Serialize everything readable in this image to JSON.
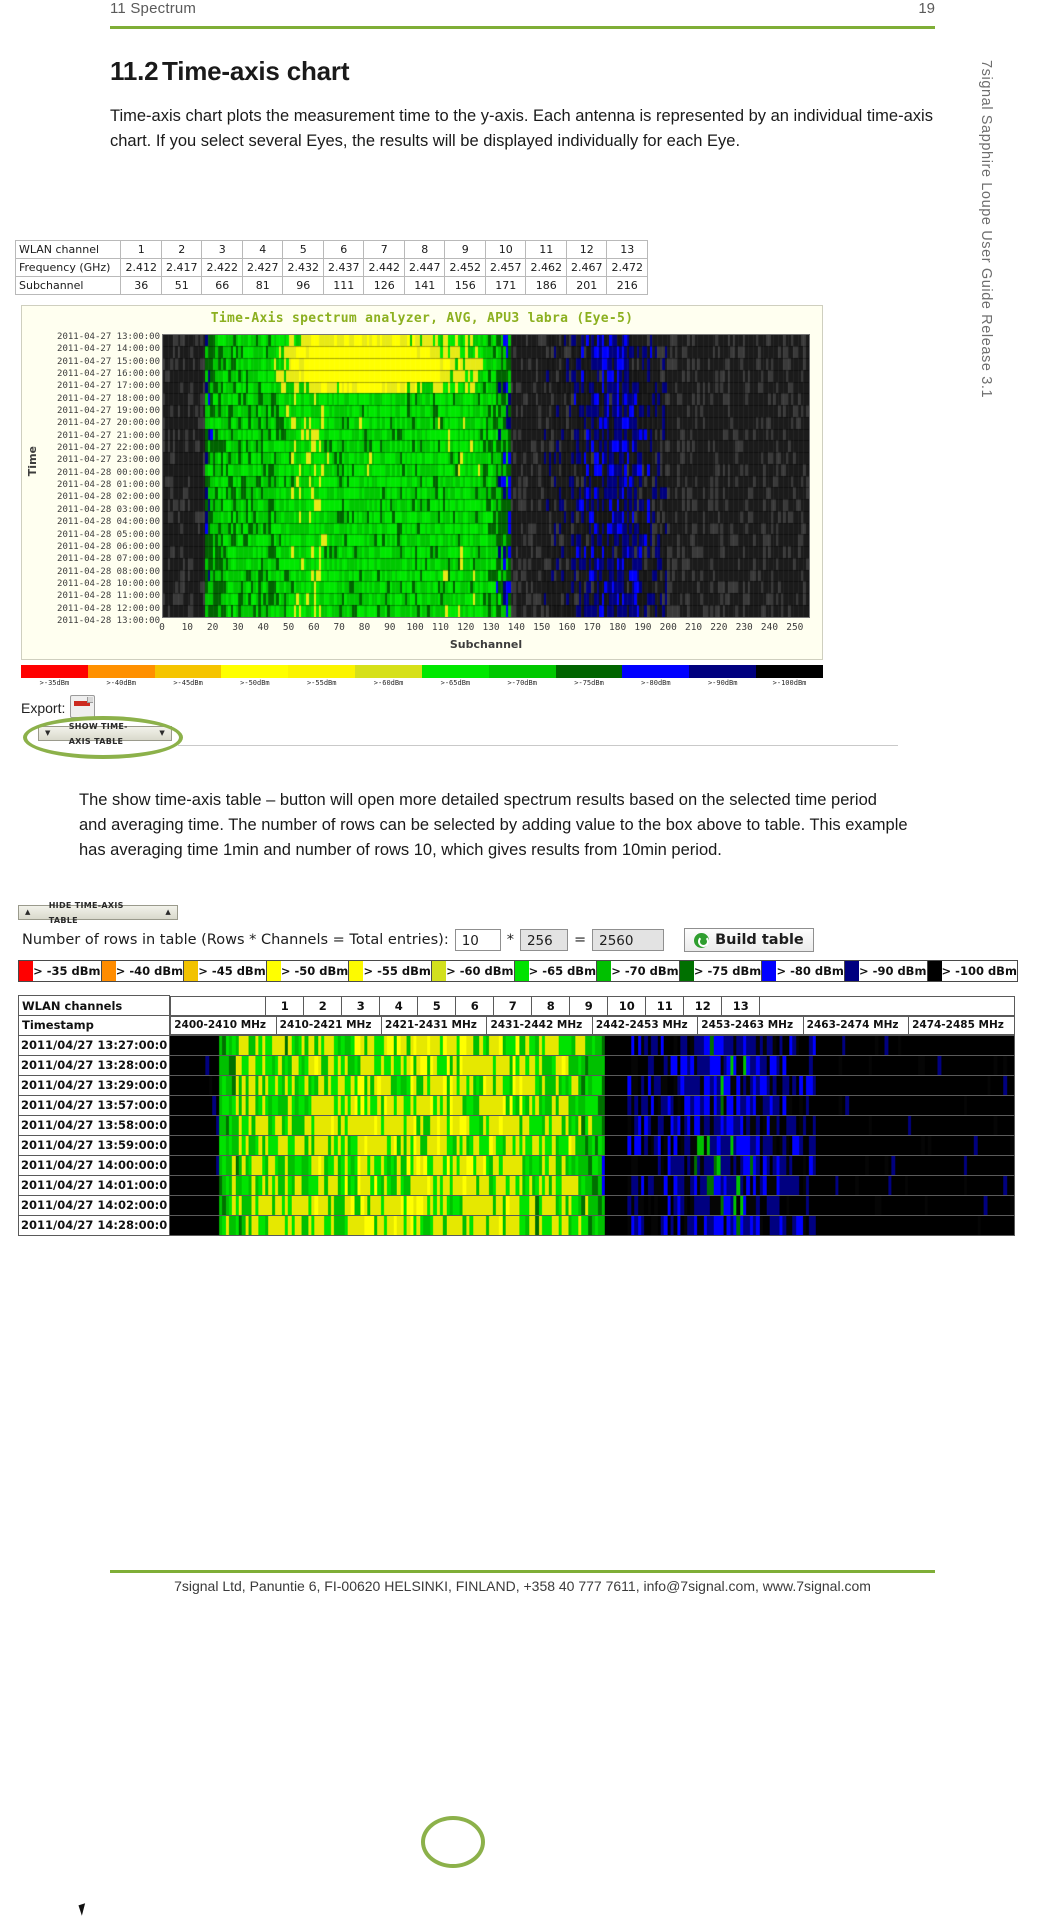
{
  "header": {
    "left": "11 Spectrum",
    "page_number": "19"
  },
  "side_text": "7signal Sapphire Loupe User Guide Release 3.1",
  "footer": "7signal Ltd, Panuntie 6, FI-00620 HELSINKI, FINLAND, +358 40 777 7611, info@7signal.com, www.7signal.com",
  "section": {
    "number": "11.2",
    "title": "Time-axis chart",
    "paragraph1": "Time-axis chart plots the measurement time to the y-axis. Each antenna is represented by an individual time-axis chart. If you select several Eyes, the results will be displayed individually for each Eye.",
    "paragraph2": "The show time-axis table – button will open more detailed spectrum results based on the selected time period and averaging time. The number of rows can be selected by adding value to the box above to table. This example has averaging time 1min and number of rows 10, which gives results from 10min period."
  },
  "wlan_table": {
    "row_labels": [
      "WLAN channel",
      "Frequency (GHz)",
      "Subchannel"
    ],
    "channels": [
      "1",
      "2",
      "3",
      "4",
      "5",
      "6",
      "7",
      "8",
      "9",
      "10",
      "11",
      "12",
      "13"
    ],
    "frequencies": [
      "2.412",
      "2.417",
      "2.422",
      "2.427",
      "2.432",
      "2.437",
      "2.442",
      "2.447",
      "2.452",
      "2.457",
      "2.462",
      "2.467",
      "2.472"
    ],
    "subchannels": [
      "36",
      "51",
      "66",
      "81",
      "96",
      "111",
      "126",
      "141",
      "156",
      "171",
      "186",
      "201",
      "216"
    ]
  },
  "chart_data": {
    "type": "heatmap",
    "title": "Time-Axis spectrum analyzer, AVG, APU3 labra (Eye-5)",
    "xlabel": "Subchannel",
    "ylabel": "Time",
    "xlim": [
      0,
      256
    ],
    "xticks": [
      "0",
      "10",
      "20",
      "30",
      "40",
      "50",
      "60",
      "70",
      "80",
      "90",
      "100",
      "110",
      "120",
      "130",
      "140",
      "150",
      "160",
      "170",
      "180",
      "190",
      "200",
      "210",
      "220",
      "230",
      "240",
      "250"
    ],
    "yticks": [
      "2011-04-27 13:00:00",
      "2011-04-27 14:00:00",
      "2011-04-27 15:00:00",
      "2011-04-27 16:00:00",
      "2011-04-27 17:00:00",
      "2011-04-27 18:00:00",
      "2011-04-27 19:00:00",
      "2011-04-27 20:00:00",
      "2011-04-27 21:00:00",
      "2011-04-27 22:00:00",
      "2011-04-27 23:00:00",
      "2011-04-28 00:00:00",
      "2011-04-28 01:00:00",
      "2011-04-28 02:00:00",
      "2011-04-28 03:00:00",
      "2011-04-28 04:00:00",
      "2011-04-28 05:00:00",
      "2011-04-28 06:00:00",
      "2011-04-28 07:00:00",
      "2011-04-28 08:00:00",
      "2011-04-28 10:00:00",
      "2011-04-28 11:00:00",
      "2011-04-28 12:00:00",
      "2011-04-28 13:00:00"
    ],
    "legend": {
      "labels": [
        ">-35dBm",
        ">-40dBm",
        ">-45dBm",
        ">-50dBm",
        ">-55dBm",
        ">-60dBm",
        ">-65dBm",
        ">-70dBm",
        ">-75dBm",
        ">-80dBm",
        ">-90dBm",
        ">-100dBm"
      ],
      "colors": [
        "#ff0000",
        "#ff9000",
        "#f5c400",
        "#ffff00",
        "#fbf400",
        "#d6e01a",
        "#00e800",
        "#00c800",
        "#006400",
        "#0000ff",
        "#00007f",
        "#000000"
      ]
    }
  },
  "export": {
    "label": "Export:",
    "icon": "pdf-icon"
  },
  "show_table_button": {
    "label": "SHOW TIME-AXIS TABLE"
  },
  "hide_table_button": {
    "label": "HIDE TIME-AXIS TABLE"
  },
  "rows_control": {
    "label": "Number of rows in table (Rows * Channels = Total entries):",
    "rows_value": "10",
    "multiply_symbol": "*",
    "channels_value": "256",
    "equals_symbol": "=",
    "total_value": "2560",
    "build_button": "Build table"
  },
  "legend2": {
    "labels": [
      "> -35 dBm",
      "> -40 dBm",
      "> -45 dBm",
      "> -50 dBm",
      "> -55 dBm",
      "> -60 dBm",
      "> -65 dBm",
      "> -70 dBm",
      "> -75 dBm",
      "> -80 dBm",
      "> -90 dBm",
      "> -100 dBm"
    ],
    "colors": [
      "#ff0000",
      "#ff8c00",
      "#f2c200",
      "#ffff00",
      "#fdfa00",
      "#d2e01e",
      "#00e300",
      "#00c000",
      "#007000",
      "#0000ff",
      "#000080",
      "#000000"
    ]
  },
  "data_table": {
    "header_channels_label": "WLAN channels",
    "channels": [
      "1",
      "2",
      "3",
      "4",
      "5",
      "6",
      "7",
      "8",
      "9",
      "10",
      "11",
      "12",
      "13"
    ],
    "timestamp_label": "Timestamp",
    "frequency_bands": [
      "2400-2410 MHz",
      "2410-2421 MHz",
      "2421-2431 MHz",
      "2431-2442 MHz",
      "2442-2453 MHz",
      "2453-2463 MHz",
      "2463-2474 MHz",
      "2474-2485 MHz"
    ],
    "rows": [
      "2011/04/27 13:27:00:0",
      "2011/04/27 13:28:00:0",
      "2011/04/27 13:29:00:0",
      "2011/04/27 13:57:00:0",
      "2011/04/27 13:58:00:0",
      "2011/04/27 13:59:00:0",
      "2011/04/27 14:00:00:0",
      "2011/04/27 14:01:00:0",
      "2011/04/27 14:02:00:0",
      "2011/04/27 14:28:00:0"
    ]
  }
}
